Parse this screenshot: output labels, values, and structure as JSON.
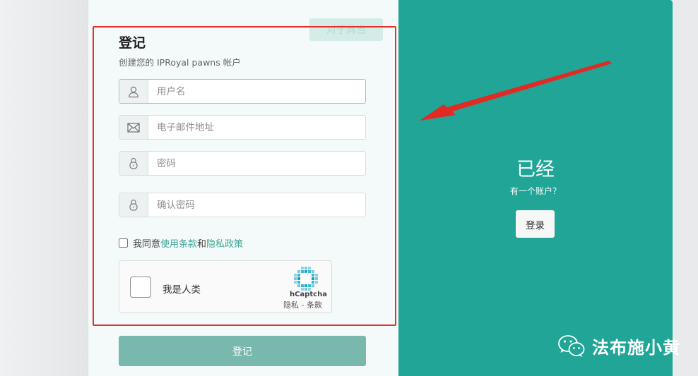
{
  "page": {
    "ghost_tab": "对于典当",
    "title": "登记",
    "subtitle": "创建您的 IPRoyal pawns 帐户"
  },
  "form": {
    "username_placeholder": "用户名",
    "email_placeholder": "电子邮件地址",
    "password_placeholder": "密码",
    "confirm_placeholder": "确认密码",
    "agree": {
      "prefix": "我同意",
      "terms_link": "使用条款",
      "and": "和 ",
      "privacy_link": "隐私政策"
    },
    "captcha": {
      "label": "我是人类",
      "brand": "hCaptcha",
      "links": "隐私 - 条款"
    },
    "submit_label": "登记"
  },
  "side": {
    "heading": "已经",
    "subheading": "有一个账户？",
    "login_label": "登录"
  },
  "watermark": {
    "text": "法布施小黄"
  },
  "colors": {
    "teal": "#20a596",
    "submit": "#79b8ad",
    "link": "#3fa597",
    "annotation_red": "#e4322b"
  }
}
